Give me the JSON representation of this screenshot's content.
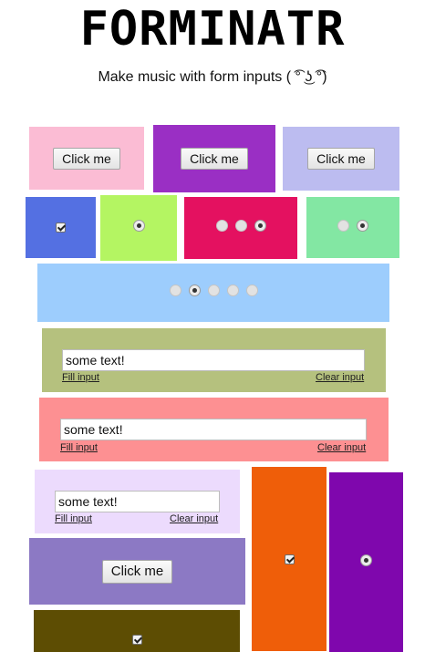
{
  "header": {
    "logo": "FORMINATR",
    "tagline": "Make music with form inputs ( ͡° ͜ʖ ͡°)"
  },
  "colors": {
    "pink": "#fbbcd4",
    "purple": "#9a2fc4",
    "lavender": "#bcbcf0",
    "blue": "#5470e2",
    "lime": "#b4f562",
    "magenta": "#e41160",
    "mint": "#83e7a3",
    "sky": "#9dcdfd",
    "olive": "#b5c17e",
    "salmon": "#fd9092",
    "lilac": "#ecdbfd",
    "violet": "#8c79c4",
    "orange": "#ef5e09",
    "deep_purple": "#7f07ad",
    "dark_olive": "#5d4d03"
  },
  "buttons": {
    "pink": "Click me",
    "purple": "Click me",
    "lavender": "Click me",
    "violet": "Click me"
  },
  "text_inputs": {
    "olive": {
      "value": "some text!",
      "fill_label": "Fill input",
      "clear_label": "Clear input"
    },
    "salmon": {
      "value": "some text!",
      "fill_label": "Fill input",
      "clear_label": "Clear input"
    },
    "lilac": {
      "value": "some text!",
      "fill_label": "Fill input",
      "clear_label": "Clear input"
    }
  },
  "radio_groups": {
    "lime": {
      "count": 1,
      "selected": 0
    },
    "magenta": {
      "count": 3,
      "selected": 2
    },
    "mint": {
      "count": 2,
      "selected": 1
    },
    "sky": {
      "count": 5,
      "selected": 1
    },
    "deep_purple": {
      "count": 1,
      "selected": 0
    }
  },
  "checkboxes": {
    "blue": true,
    "orange": true,
    "dark_olive": true
  }
}
